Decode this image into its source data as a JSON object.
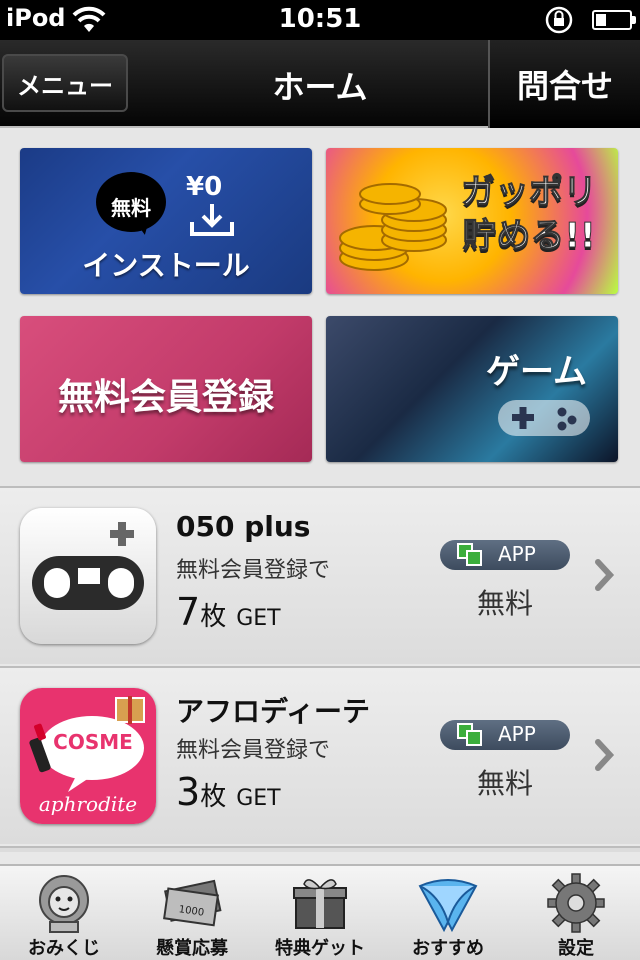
{
  "status_bar": {
    "carrier": "iPod",
    "time": "10:51",
    "battery_level": 0.3
  },
  "nav": {
    "menu_label": "メニュー",
    "title": "ホーム",
    "contact_label": "問合せ"
  },
  "banners": {
    "install": {
      "badge": "無料",
      "yen": "¥0",
      "label": "インストール"
    },
    "gappori": {
      "label_line1": "ガッポリ",
      "label_line2": "貯める!!"
    },
    "member": {
      "label": "無料会員登録"
    },
    "game": {
      "label": "ゲーム"
    }
  },
  "apps": [
    {
      "name": "050 plus",
      "condition": "無料会員登録で",
      "reward_num": "7",
      "reward_unit": "枚",
      "reward_get": "GET",
      "badge": "APP",
      "price": "無料",
      "icon": "050-plus-icon"
    },
    {
      "name": "アフロディーテ",
      "condition": "無料会員登録で",
      "reward_num": "3",
      "reward_unit": "枚",
      "reward_get": "GET",
      "badge": "APP",
      "price": "無料",
      "icon": "cosme-aphrodite-icon",
      "icon_text_top": "COSME",
      "icon_text_bottom": "aphrodite"
    }
  ],
  "tabs": [
    {
      "label": "おみくじ",
      "icon": "lion-icon"
    },
    {
      "label": "懸賞応募",
      "icon": "money-icon"
    },
    {
      "label": "特典ゲット",
      "icon": "gift-icon"
    },
    {
      "label": "おすすめ",
      "icon": "bird-icon",
      "active": true
    },
    {
      "label": "設定",
      "icon": "gear-icon"
    }
  ],
  "colors": {
    "nav_bg": "#000000",
    "badge_bg": "#4a586c",
    "install_banner": "#1f4597",
    "member_banner": "#c83d6c"
  }
}
